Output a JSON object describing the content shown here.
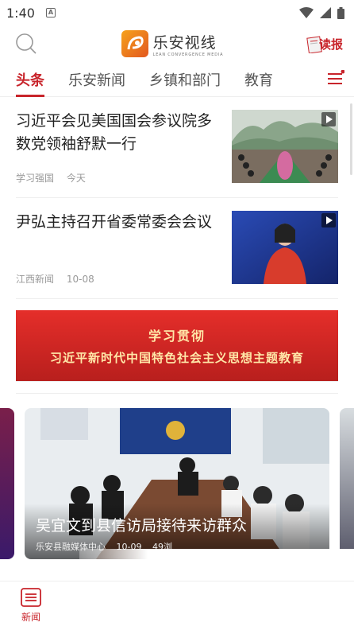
{
  "status_bar": {
    "time": "1:40",
    "app_icon": "A"
  },
  "header": {
    "brand_name": "乐安视线",
    "brand_sub": "LEAN CONVERGENCE MEDIA",
    "read_label": "读报"
  },
  "tabs": [
    {
      "label": "头条",
      "active": true
    },
    {
      "label": "乐安新闻"
    },
    {
      "label": "乡镇和部门"
    },
    {
      "label": "教育"
    }
  ],
  "news": [
    {
      "title": "习近平会见美国国会参议院多数党领袖舒默一行",
      "source": "学习强国",
      "time": "今天"
    },
    {
      "title": "尹弘主持召开省委常委会会议",
      "source": "江西新闻",
      "time": "10-08"
    }
  ],
  "banner": {
    "line1": "学习贯彻",
    "line2": "习近平新时代中国特色社会主义思想主题教育"
  },
  "carousel": {
    "title": "吴宜文到县信访局接待来访群众",
    "source": "乐安县融媒体中心",
    "time": "10-09",
    "extra": "49浏"
  },
  "bottom_nav": {
    "label": "新闻"
  },
  "colors": {
    "accent": "#c8242b"
  }
}
